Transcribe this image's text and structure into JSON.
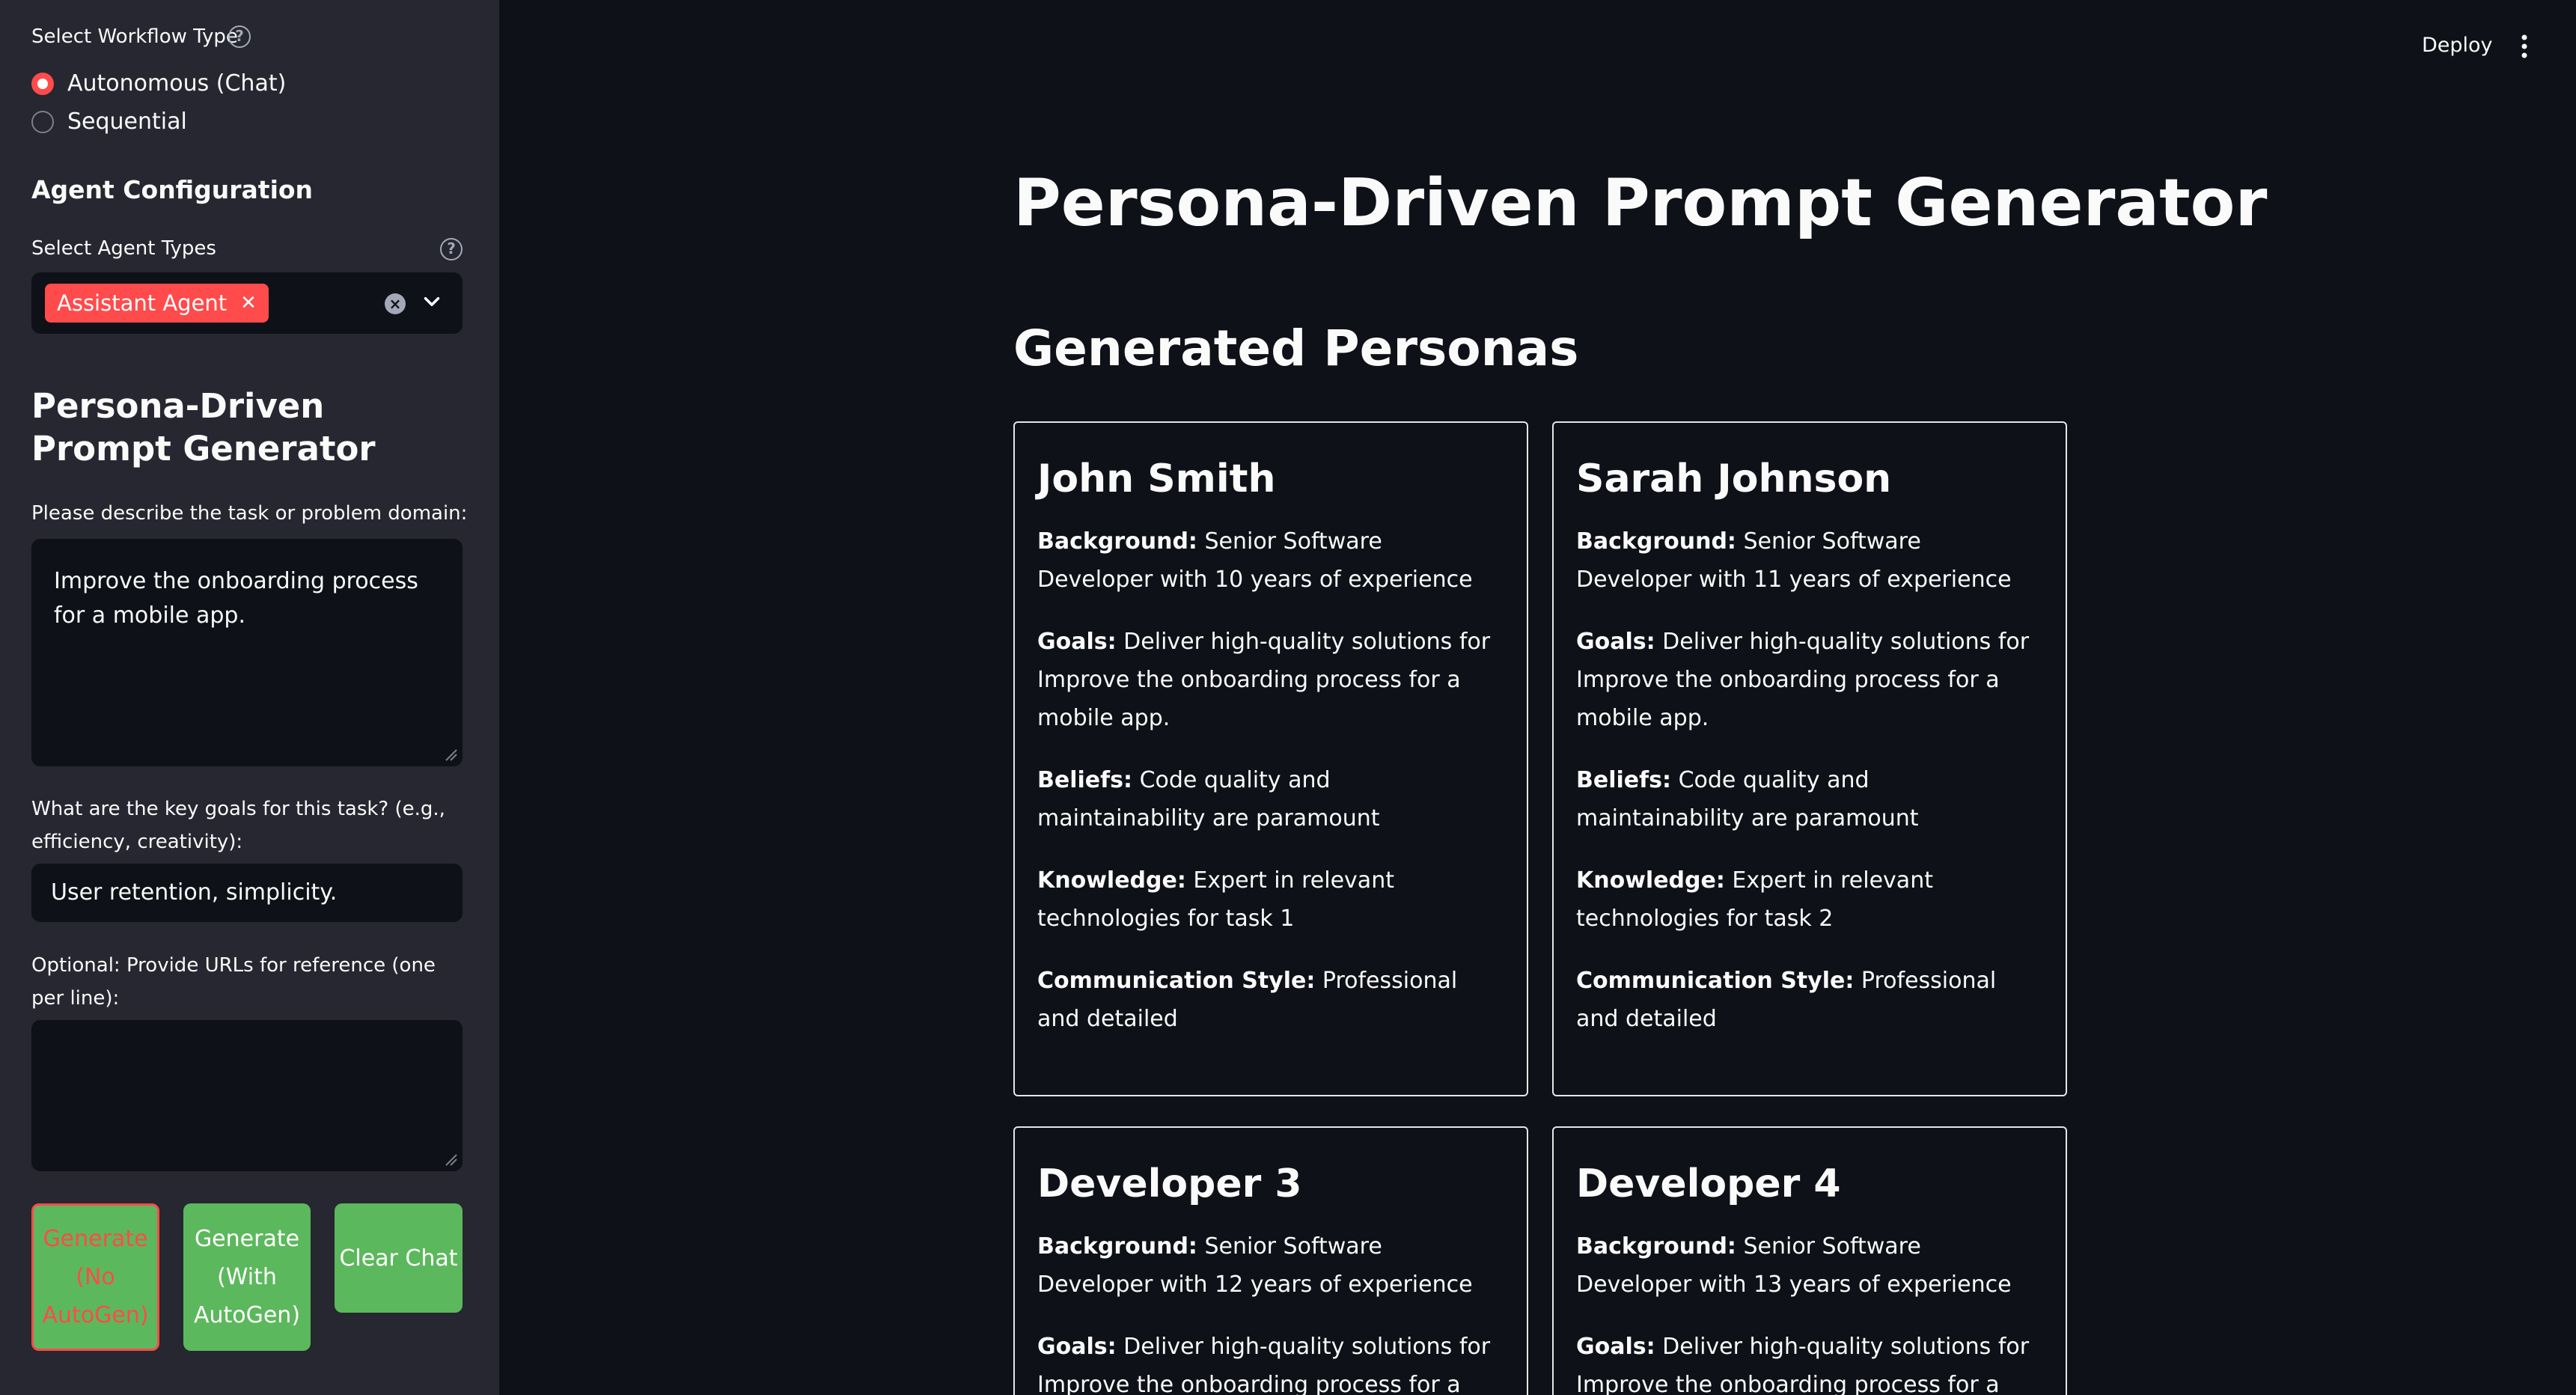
{
  "sidebar": {
    "workflow_label": "Select Workflow Type",
    "workflow_options": [
      "Autonomous (Chat)",
      "Sequential"
    ],
    "workflow_selected": "Autonomous (Chat)",
    "agent_config_heading": "Agent Configuration",
    "agent_types_label": "Select Agent Types",
    "agent_types_selected": [
      "Assistant Agent"
    ],
    "section_heading": "Persona-Driven Prompt Generator",
    "task_label": "Please describe the task or problem domain:",
    "task_value": "Improve the onboarding process for a mobile app.",
    "goals_label": "What are the key goals for this task? (e.g., efficiency, creativity):",
    "goals_value": "User retention, simplicity.",
    "urls_label": "Optional: Provide URLs for reference (one per line):",
    "urls_value": "",
    "buttons": {
      "generate_no_autogen": "Generate (No AutoGen)",
      "generate_with_autogen": "Generate (With AutoGen)",
      "clear_chat": "Clear Chat"
    }
  },
  "header": {
    "deploy_label": "Deploy"
  },
  "main": {
    "title": "Persona-Driven Prompt Generator",
    "subtitle": "Generated Personas",
    "labels": {
      "background": "Background:",
      "goals": "Goals:",
      "beliefs": "Beliefs:",
      "knowledge": "Knowledge:",
      "communication": "Communication Style:"
    },
    "personas": [
      {
        "name": "John Smith",
        "background": "Senior Software Developer with 10 years of experience",
        "goals": "Deliver high-quality solutions for Improve the onboarding process for a mobile app.",
        "beliefs": "Code quality and maintainability are paramount",
        "knowledge": "Expert in relevant technologies for task 1",
        "communication": "Professional and detailed"
      },
      {
        "name": "Sarah Johnson",
        "background": "Senior Software Developer with 11 years of experience",
        "goals": "Deliver high-quality solutions for Improve the onboarding process for a mobile app.",
        "beliefs": "Code quality and maintainability are paramount",
        "knowledge": "Expert in relevant technologies for task 2",
        "communication": "Professional and detailed"
      },
      {
        "name": "Developer 3",
        "background": "Senior Software Developer with 12 years of experience",
        "goals": "Deliver high-quality solutions for Improve the onboarding process for a mobile app.",
        "beliefs": "",
        "knowledge": "",
        "communication": ""
      },
      {
        "name": "Developer 4",
        "background": "Senior Software Developer with 13 years of experience",
        "goals": "Deliver high-quality solutions for Improve the onboarding process for a mobile app.",
        "beliefs": "",
        "knowledge": "",
        "communication": ""
      }
    ]
  },
  "colors": {
    "accent": "#ff4b4b",
    "button_green": "#5cb85c",
    "sidebar_bg": "#262730",
    "main_bg": "#0e1117"
  }
}
